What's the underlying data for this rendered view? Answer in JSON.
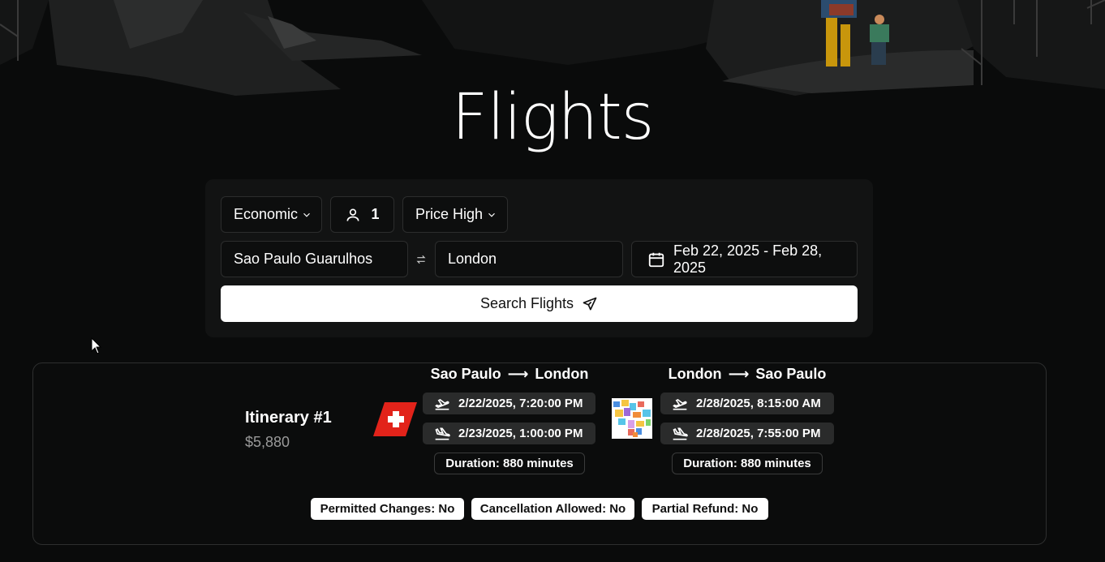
{
  "page": {
    "title": "Flights"
  },
  "search": {
    "cabin": "Economic",
    "passengers": "1",
    "sort": "Price High",
    "origin": "Sao Paulo Guarulhos",
    "destination": "London",
    "dates": "Feb 22, 2025 - Feb 28, 2025",
    "search_label": "Search Flights"
  },
  "results": [
    {
      "title": "Itinerary #1",
      "price": "$5,880",
      "outbound": {
        "from": "Sao Paulo",
        "to": "London",
        "arrow": "⟶",
        "departure": "2/22/2025, 7:20:00 PM",
        "arrival": "2/23/2025, 1:00:00 PM",
        "duration": "Duration: 880 minutes"
      },
      "return": {
        "from": "London",
        "to": "Sao Paulo",
        "arrow": "⟶",
        "departure": "2/28/2025, 8:15:00 AM",
        "arrival": "2/28/2025, 7:55:00 PM",
        "duration": "Duration: 880 minutes"
      },
      "badges": {
        "changes": "Permitted Changes: No",
        "cancellation": "Cancellation Allowed: No",
        "refund": "Partial Refund: No"
      }
    }
  ],
  "colors": {
    "background": "#0a0b0b",
    "panel": "#121313",
    "swiss_red": "#e2231a"
  }
}
